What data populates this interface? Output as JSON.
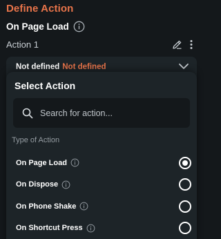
{
  "header": {
    "title": "Define Action"
  },
  "trigger": {
    "label": "On Page Load",
    "icon": "info-icon"
  },
  "action": {
    "label": "Action 1",
    "edit_icon": "pencil-icon",
    "menu_icon": "more-vertical-icon"
  },
  "action_select": {
    "label": "Not defined",
    "status": "Not defined",
    "status_color": "#e8744a",
    "icon": "chevron-down-icon"
  },
  "panel": {
    "title": "Select Action",
    "search": {
      "placeholder": "Search for action...",
      "value": "",
      "icon": "search-icon"
    },
    "section_label": "Type of Action",
    "options": [
      {
        "label": "On Page Load",
        "selected": true
      },
      {
        "label": "On Dispose",
        "selected": false
      },
      {
        "label": "On Phone Shake",
        "selected": false
      },
      {
        "label": "On Shortcut Press",
        "selected": false
      }
    ]
  },
  "colors": {
    "accent": "#e8744a",
    "background": "#14181b",
    "panel": "#1d2428"
  }
}
